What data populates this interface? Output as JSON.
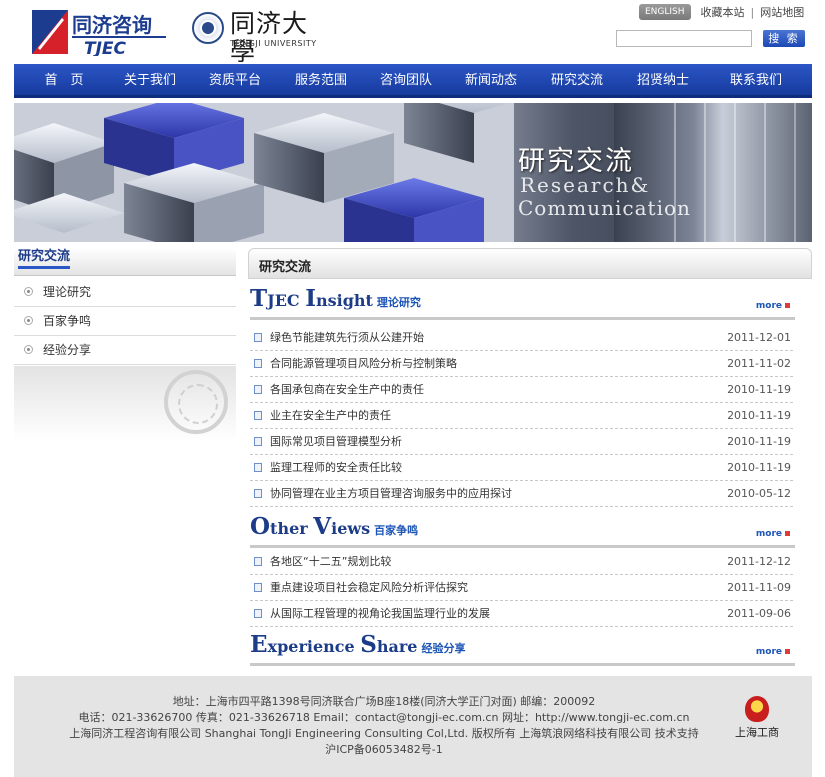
{
  "header": {
    "logo_cn": "同济咨询",
    "logo_en": "TJEC",
    "univ_cn": "同济大學",
    "univ_en": "TONGJI UNIVERSITY",
    "english_btn": "ENGLISH",
    "bookmark": "收藏本站",
    "sep": "|",
    "sitemap": "网站地图",
    "search_value": "",
    "search_btn": "搜 索"
  },
  "nav": [
    "首　页",
    "关于我们",
    "资质平台",
    "服务范围",
    "咨询团队",
    "新闻动态",
    "研究交流",
    "招贤纳士",
    "联系我们"
  ],
  "banner": {
    "title": "研究交流",
    "sub1": "Research&",
    "sub2": "Communication"
  },
  "sidebar": {
    "title": "研究交流",
    "items": [
      "理论研究",
      "百家争鸣",
      "经验分享"
    ]
  },
  "main": {
    "title": "研究交流",
    "more": "more",
    "sections": [
      {
        "cap1": "T",
        "rest1": "JEC ",
        "cap2": "I",
        "rest2": "nsight",
        "cn": "理论研究",
        "rows": [
          {
            "title": "绿色节能建筑先行须从公建开始",
            "date": "2011-12-01"
          },
          {
            "title": "合同能源管理项目风险分析与控制策略",
            "date": "2011-11-02"
          },
          {
            "title": "各国承包商在安全生产中的责任",
            "date": "2010-11-19"
          },
          {
            "title": "业主在安全生产中的责任",
            "date": "2010-11-19"
          },
          {
            "title": "国际常见项目管理模型分析",
            "date": "2010-11-19"
          },
          {
            "title": "监理工程师的安全责任比较",
            "date": "2010-11-19"
          },
          {
            "title": "协同管理在业主方项目管理咨询服务中的应用探讨",
            "date": "2010-05-12"
          }
        ]
      },
      {
        "cap1": "O",
        "rest1": "ther ",
        "cap2": "V",
        "rest2": "iews",
        "cn": "百家争鸣",
        "rows": [
          {
            "title": "各地区“十二五”规划比较",
            "date": "2011-12-12"
          },
          {
            "title": "重点建设项目社会稳定风险分析评估探究",
            "date": "2011-11-09"
          },
          {
            "title": "从国际工程管理的视角论我国监理行业的发展",
            "date": "2011-09-06"
          }
        ]
      },
      {
        "cap1": "E",
        "rest1": "xperience ",
        "cap2": "S",
        "rest2": "hare",
        "cn": "经验分享",
        "rows": []
      }
    ]
  },
  "footer": {
    "line1": "地址：上海市四平路1398号同济联合广场B座18楼(同济大学正门对面) 邮编：200092",
    "line2": "电话：021-33626700 传真：021-33626718 Email：contact@tongji-ec.com.cn 网址：http://www.tongji-ec.com.cn",
    "line3": "上海同济工程咨询有限公司 Shanghai TongJi Engineering Consulting Col,Ltd. 版权所有 上海筑浪网络科技有限公司 技术支持",
    "line4": "沪ICP备06053482号-1",
    "badge": "上海工商"
  },
  "colors": {
    "nav_blue": "#1f47b0",
    "link_blue": "#1c55b5",
    "title_blue": "#1c3c88"
  }
}
